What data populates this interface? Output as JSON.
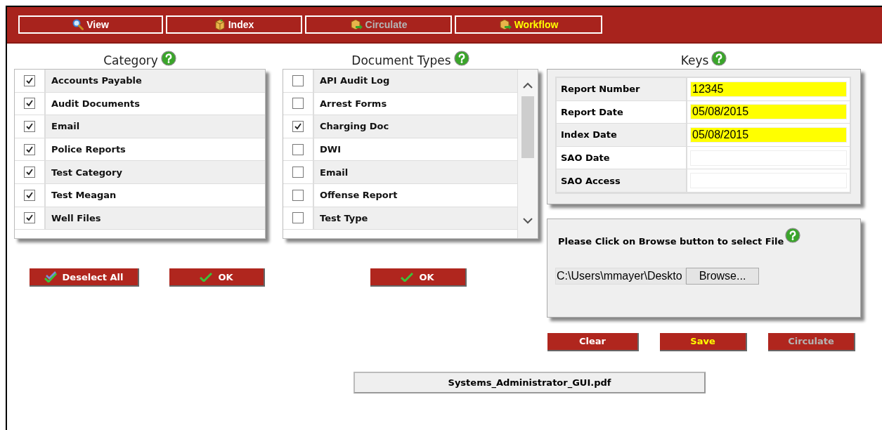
{
  "tabs": [
    {
      "label": "View",
      "selected": false,
      "disabled": false
    },
    {
      "label": "Index",
      "selected": false,
      "disabled": false
    },
    {
      "label": "Circulate",
      "selected": false,
      "disabled": true
    },
    {
      "label": "Workflow",
      "selected": true,
      "disabled": false
    }
  ],
  "category": {
    "title": "Category",
    "items": [
      {
        "label": "Accounts Payable",
        "checked": true
      },
      {
        "label": "Audit Documents",
        "checked": true
      },
      {
        "label": "Email",
        "checked": true
      },
      {
        "label": "Police Reports",
        "checked": true
      },
      {
        "label": "Test Category",
        "checked": true
      },
      {
        "label": "Test Meagan",
        "checked": true
      },
      {
        "label": "Well Files",
        "checked": true
      }
    ],
    "buttons": [
      {
        "label": "Deselect All"
      },
      {
        "label": "OK"
      }
    ]
  },
  "document_types": {
    "title": "Document Types",
    "items": [
      {
        "label": "API Audit Log",
        "checked": false
      },
      {
        "label": "Arrest Forms",
        "checked": false
      },
      {
        "label": "Charging Doc",
        "checked": true
      },
      {
        "label": "DWI",
        "checked": false
      },
      {
        "label": "Email",
        "checked": false
      },
      {
        "label": "Offense Report",
        "checked": false
      },
      {
        "label": "Test Type",
        "checked": false
      }
    ],
    "buttons": [
      {
        "label": "OK"
      }
    ]
  },
  "keys": {
    "title": "Keys",
    "fields": [
      {
        "label": "Report Number",
        "value": "12345",
        "highlighted": true
      },
      {
        "label": "Report Date",
        "value": "05/08/2015",
        "highlighted": true
      },
      {
        "label": "Index Date",
        "value": "05/08/2015",
        "highlighted": true
      },
      {
        "label": "SAO Date",
        "highlighted": false
      },
      {
        "label": "SAO Access",
        "highlighted": false
      }
    ]
  },
  "file_upload": {
    "prompt": "Please Click on Browse button to select File",
    "path": "C:\\Users\\mmayer\\Deskto",
    "browse_label": "Browse..."
  },
  "actions": [
    {
      "label": "Clear",
      "emphasis": false,
      "disabled": false
    },
    {
      "label": "Save",
      "emphasis": true,
      "disabled": false
    },
    {
      "label": "Circulate",
      "emphasis": false,
      "disabled": true
    }
  ],
  "document_name": "Systems_Administrator_GUI.pdf"
}
